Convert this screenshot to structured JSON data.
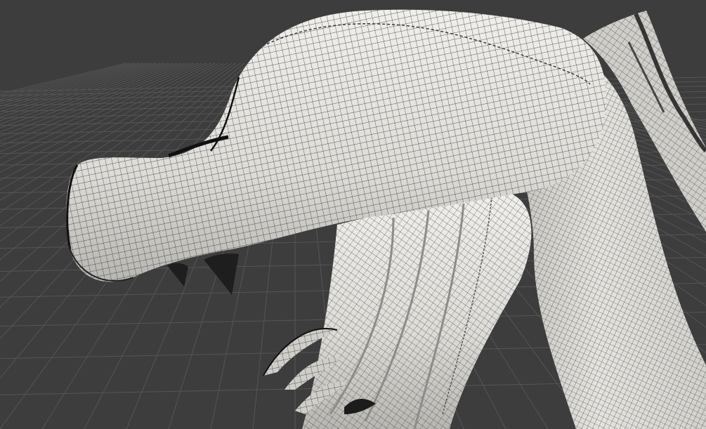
{
  "app": {
    "name": "3D viewport",
    "view_mode": "wireframe-on-shaded"
  },
  "colors": {
    "background": "#3d3d3d",
    "grid_line": "#4a4a4a",
    "grid_line_major": "#555555",
    "mesh_surface": "#d8d7d2",
    "mesh_surface_shadow": "#b9b8b3",
    "mesh_surface_highlight": "#efeeea",
    "wire": "#2a2a2a",
    "teeth": "#1e1e1e"
  },
  "scene": {
    "object": "dragon-head-sculpt",
    "parts": [
      "snout",
      "head",
      "neck",
      "jaw-horns",
      "teeth",
      "claws",
      "back-spine"
    ]
  }
}
